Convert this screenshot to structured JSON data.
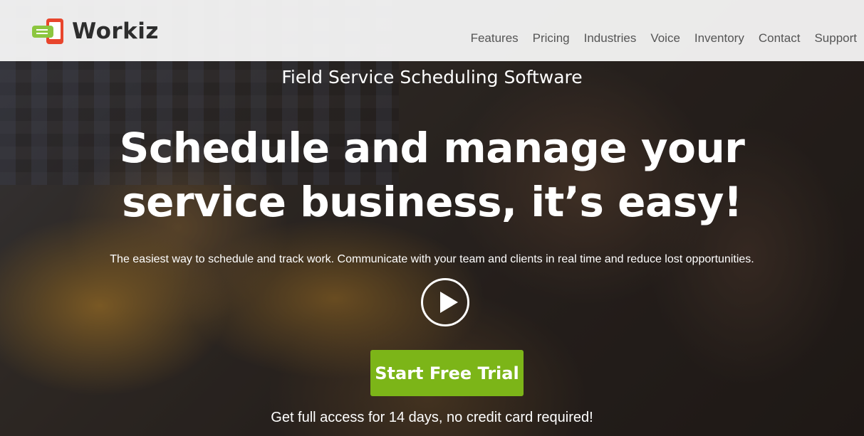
{
  "header": {
    "logo_text": "Workiz",
    "logo_icon": "phone-chat-icon",
    "nav": [
      {
        "label": "Features"
      },
      {
        "label": "Pricing"
      },
      {
        "label": "Industries"
      },
      {
        "label": "Voice"
      },
      {
        "label": "Inventory"
      },
      {
        "label": "Contact"
      },
      {
        "label": "Support"
      }
    ]
  },
  "hero": {
    "eyebrow": "Field Service Scheduling Software",
    "headline": "Schedule and manage your service business, it’s easy!",
    "subtext": "The easiest way to schedule and track work. Communicate with your team and clients in real time and reduce lost opportunities.",
    "play_icon": "play-icon",
    "cta_label": "Start Free Trial",
    "cta_note": "Get full access for 14 days, no credit card required!"
  },
  "colors": {
    "cta": "#7cb518",
    "logo_green": "#8cc63f",
    "logo_red": "#e8452c",
    "nav_text": "#555555"
  }
}
